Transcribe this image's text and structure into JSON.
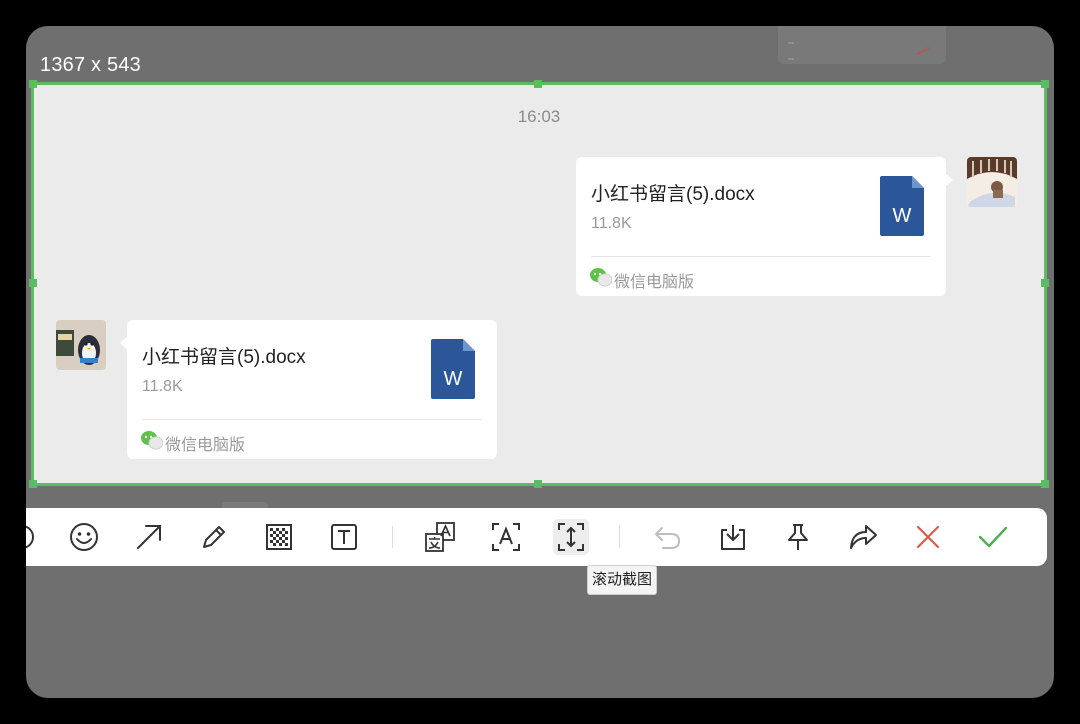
{
  "capture": {
    "size_label": "1367 x 543",
    "accent_color": "#5dbb63"
  },
  "chat": {
    "timestamp": "16:03",
    "messages": [
      {
        "side": "right",
        "file_name": "小红书留言(5).docx",
        "file_size": "11.8K",
        "source": "微信电脑版",
        "file_icon": "word-doc-icon"
      },
      {
        "side": "left",
        "file_name": "小红书留言(5).docx",
        "file_size": "11.8K",
        "source": "微信电脑版",
        "file_icon": "word-doc-icon"
      }
    ]
  },
  "toolbar": {
    "tools": [
      "ellipse-tool-icon",
      "emoji-icon",
      "arrow-icon",
      "pencil-icon",
      "mosaic-icon",
      "text-icon",
      "translate-icon",
      "ocr-icon",
      "scroll-capture-icon",
      "undo-icon",
      "download-icon",
      "pin-icon",
      "share-icon",
      "cancel-icon",
      "confirm-icon"
    ],
    "tooltip": "滚动截图",
    "cancel_color": "#e05a4f",
    "confirm_color": "#4cb04f"
  }
}
